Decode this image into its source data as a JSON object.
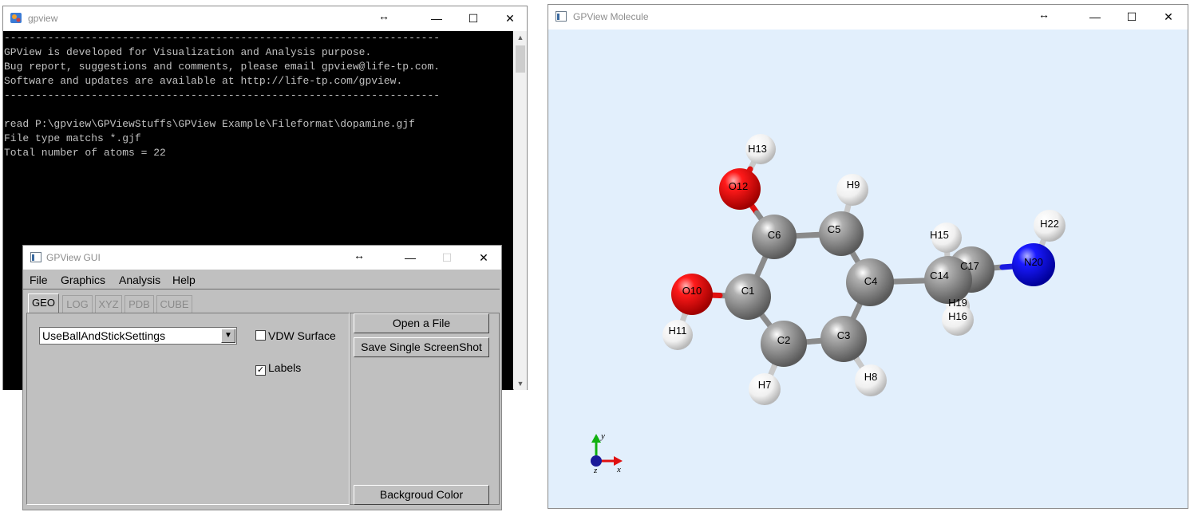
{
  "console_window": {
    "title": "gpview",
    "lines": [
      "----------------------------------------------------------------------",
      "GPView is developed for Visualization and Analysis purpose.",
      "Bug report, suggestions and comments, please email gpview@life-tp.com.",
      "Software and updates are available at http://life-tp.com/gpview.",
      "----------------------------------------------------------------------",
      "",
      "read P:\\gpview\\GPViewStuffs\\GPView Example\\Fileformat\\dopamine.gjf",
      "File type matchs *.gjf",
      "Total number of atoms = 22"
    ]
  },
  "gui_window": {
    "title": "GPView GUI",
    "menu": [
      "File",
      "Graphics",
      "Analysis",
      "Help"
    ],
    "tabs": [
      {
        "label": "GEO",
        "active": true
      },
      {
        "label": "LOG",
        "active": false
      },
      {
        "label": "XYZ",
        "active": false
      },
      {
        "label": "PDB",
        "active": false
      },
      {
        "label": "CUBE",
        "active": false
      }
    ],
    "settings_select": {
      "value": "UseBallAndStickSettings"
    },
    "vdw_surface": {
      "label": "VDW Surface",
      "checked": false
    },
    "labels": {
      "label": "Labels",
      "checked": true
    },
    "buttons": {
      "open_file": "Open a File",
      "save_screenshot": "Save Single ScreenShot",
      "background_color": "Backgroud Color"
    }
  },
  "molecule_window": {
    "title": "GPView Molecule",
    "atoms": [
      {
        "label": "H13",
        "element": "H"
      },
      {
        "label": "O12",
        "element": "O"
      },
      {
        "label": "H9",
        "element": "H"
      },
      {
        "label": "C6",
        "element": "C"
      },
      {
        "label": "C5",
        "element": "C"
      },
      {
        "label": "H15",
        "element": "H"
      },
      {
        "label": "H22",
        "element": "H"
      },
      {
        "label": "C4",
        "element": "C"
      },
      {
        "label": "C14",
        "element": "C"
      },
      {
        "label": "C17",
        "element": "C"
      },
      {
        "label": "N20",
        "element": "N"
      },
      {
        "label": "O10",
        "element": "O"
      },
      {
        "label": "C1",
        "element": "C"
      },
      {
        "label": "H19",
        "element": "H"
      },
      {
        "label": "H16",
        "element": "H"
      },
      {
        "label": "H11",
        "element": "H"
      },
      {
        "label": "C2",
        "element": "C"
      },
      {
        "label": "C3",
        "element": "C"
      },
      {
        "label": "H8",
        "element": "H"
      },
      {
        "label": "H7",
        "element": "H"
      }
    ],
    "axes": {
      "x": "x",
      "y": "y",
      "z": "z"
    },
    "colors": {
      "C": "#8a8a8a",
      "H": "#f2f2f2",
      "O": "#e01010",
      "N": "#1a1ae0",
      "background": "#e2effc"
    }
  }
}
